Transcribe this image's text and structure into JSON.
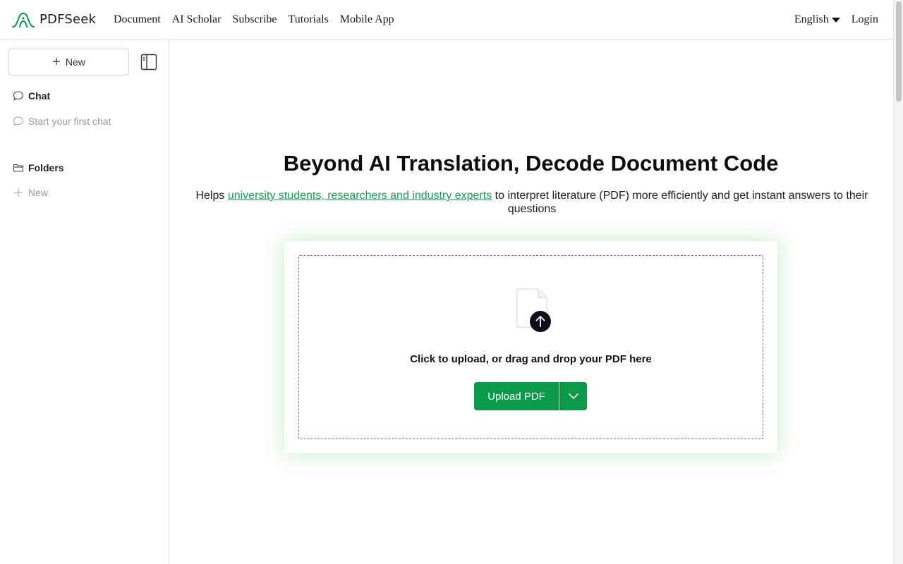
{
  "brand": {
    "name": "PDFSeek",
    "color": "#0b9a4a"
  },
  "nav": {
    "items": [
      "Document",
      "AI Scholar",
      "Subscribe",
      "Tutorials",
      "Mobile App"
    ]
  },
  "header": {
    "language": "English",
    "login": "Login"
  },
  "sidebar": {
    "new_label": "New",
    "chat_heading": "Chat",
    "chat_empty": "Start your first chat",
    "folders_heading": "Folders",
    "folders_new": "New"
  },
  "hero": {
    "title": "Beyond AI Translation, Decode Document Code",
    "sub_prefix": "Helps ",
    "sub_link": "university students, researchers and industry experts",
    "sub_suffix": " to interpret literature (PDF) more efficiently and get instant answers to their questions"
  },
  "upload": {
    "drop_text": "Click to upload, or drag and drop your PDF here",
    "button_label": "Upload PDF"
  },
  "icons": {
    "logo": "pdfseek-logo-icon",
    "sidebar_toggle": "sidebar-toggle-icon",
    "chat": "chat-bubble-icon",
    "folder": "folder-icon",
    "plus": "plus-icon",
    "file_upload": "file-upload-icon",
    "chevron": "chevron-down-icon"
  }
}
